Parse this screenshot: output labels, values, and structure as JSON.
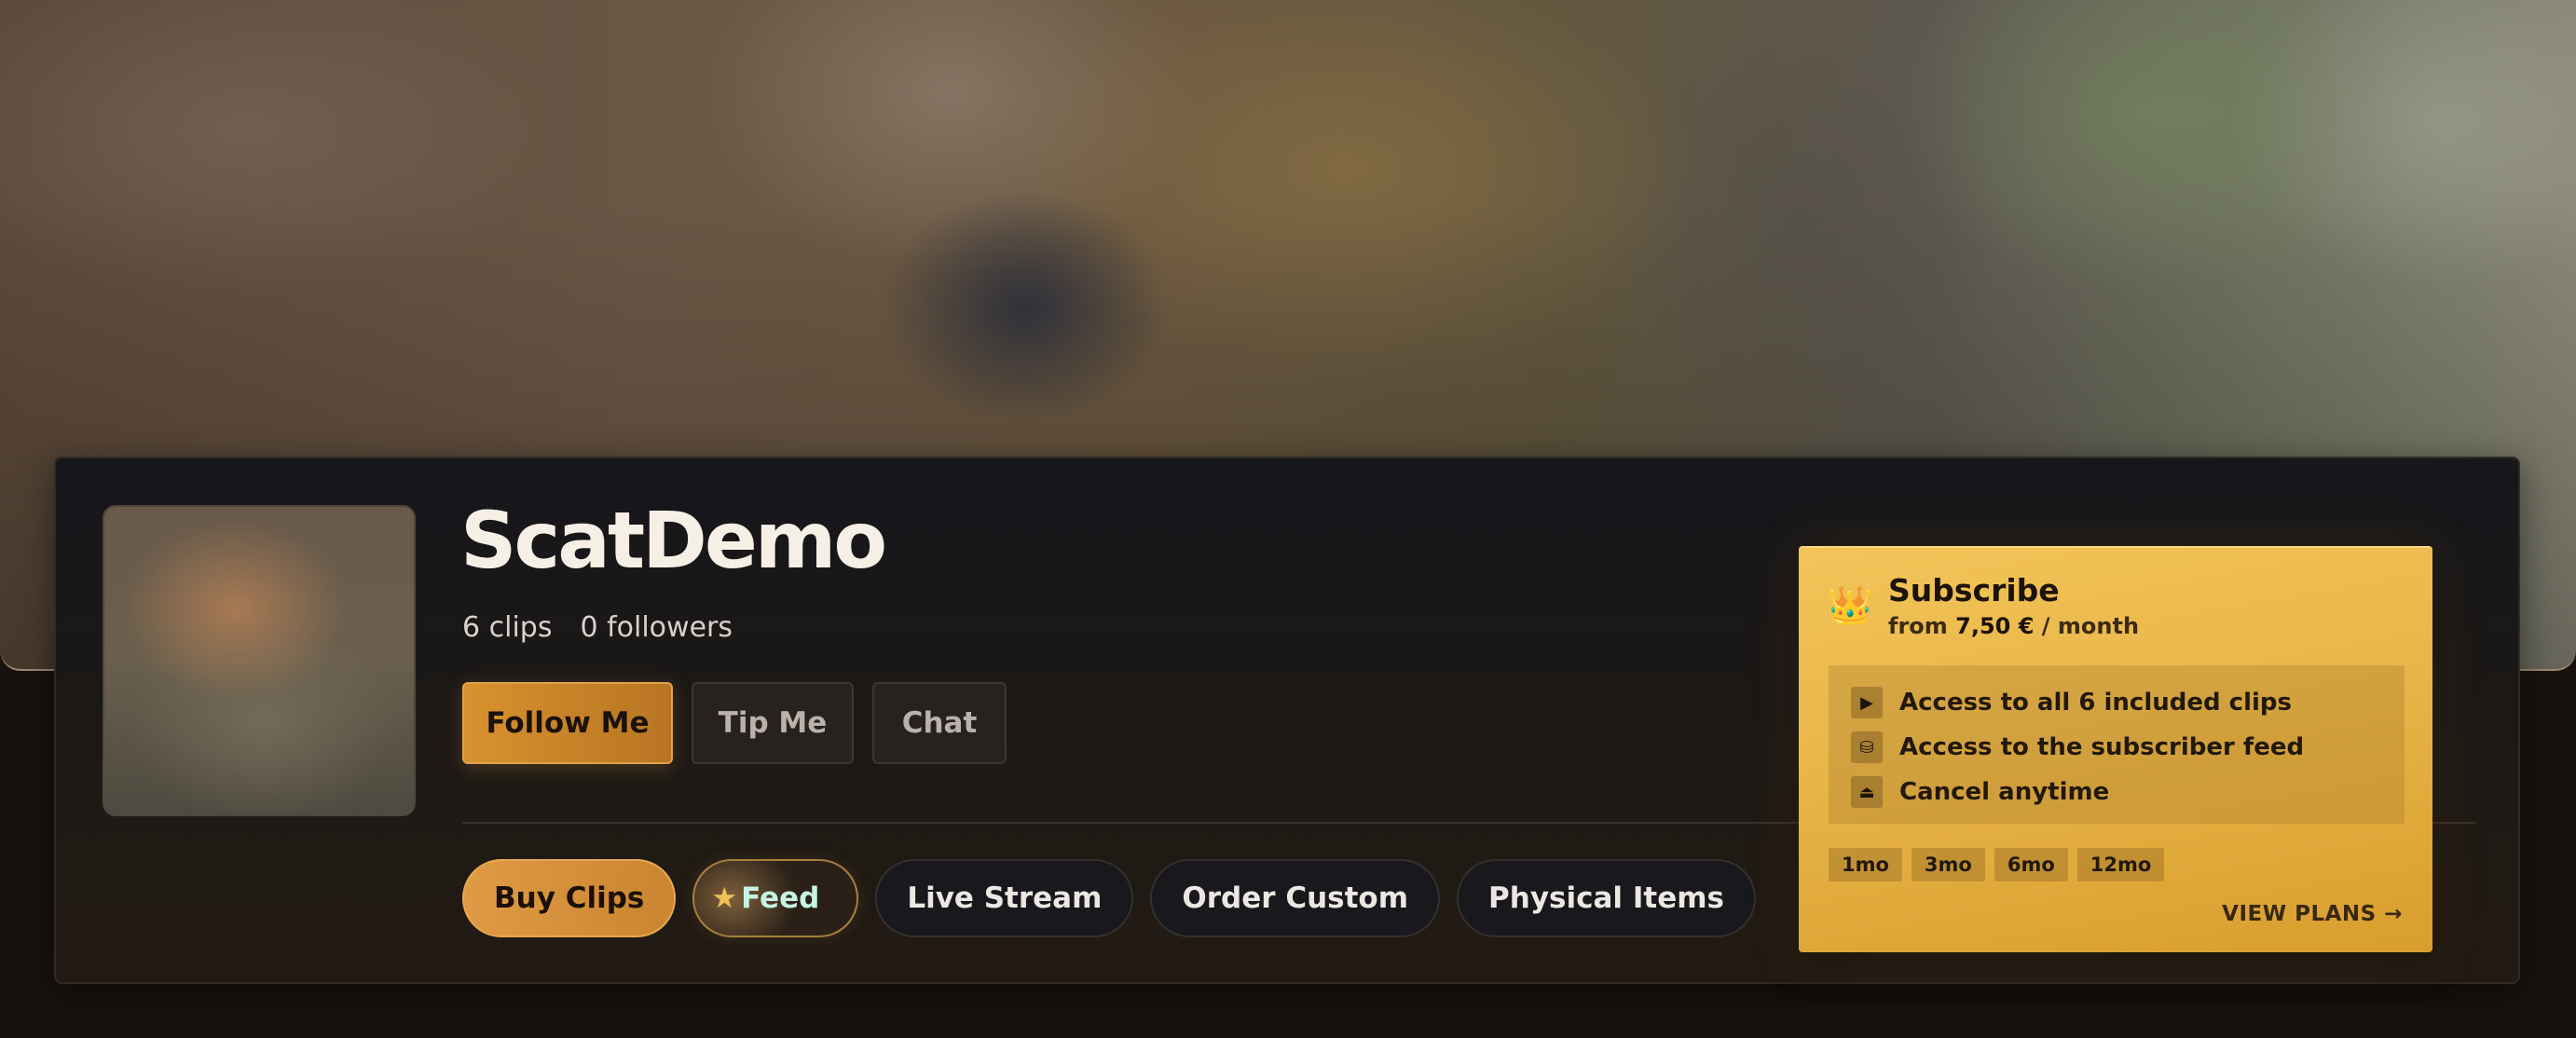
{
  "profile": {
    "name": "ScatDemo",
    "clips_count": "6 clips",
    "followers_count": "0 followers"
  },
  "actions": {
    "follow_label": "Follow Me",
    "tip_label": "Tip Me",
    "chat_label": "Chat"
  },
  "tabs": {
    "buy_clips": "Buy Clips",
    "feed_star": "★",
    "feed": "Feed",
    "live_stream": "Live Stream",
    "order_custom": "Order Custom",
    "physical_items": "Physical Items"
  },
  "subscribe": {
    "icon": "👑",
    "title": "Subscribe",
    "price_prefix": "from ",
    "price": "7,50 €",
    "price_suffix": " / month",
    "features": [
      {
        "icon": "▶",
        "icon_name": "play-icon",
        "label": "Access to all 6 included clips"
      },
      {
        "icon": "⛁",
        "icon_name": "feed-icon",
        "label": "Access to the subscriber feed"
      },
      {
        "icon": "⏏",
        "icon_name": "eject-icon",
        "label": "Cancel anytime"
      }
    ],
    "plans": [
      "1mo",
      "3mo",
      "6mo",
      "12mo"
    ],
    "view_plans": "VIEW PLANS →"
  },
  "colors": {
    "accent": "#d8922e",
    "subscribe_bg": "#e8b548",
    "page_bg": "#17120e",
    "card_bg": "#1b1816"
  }
}
